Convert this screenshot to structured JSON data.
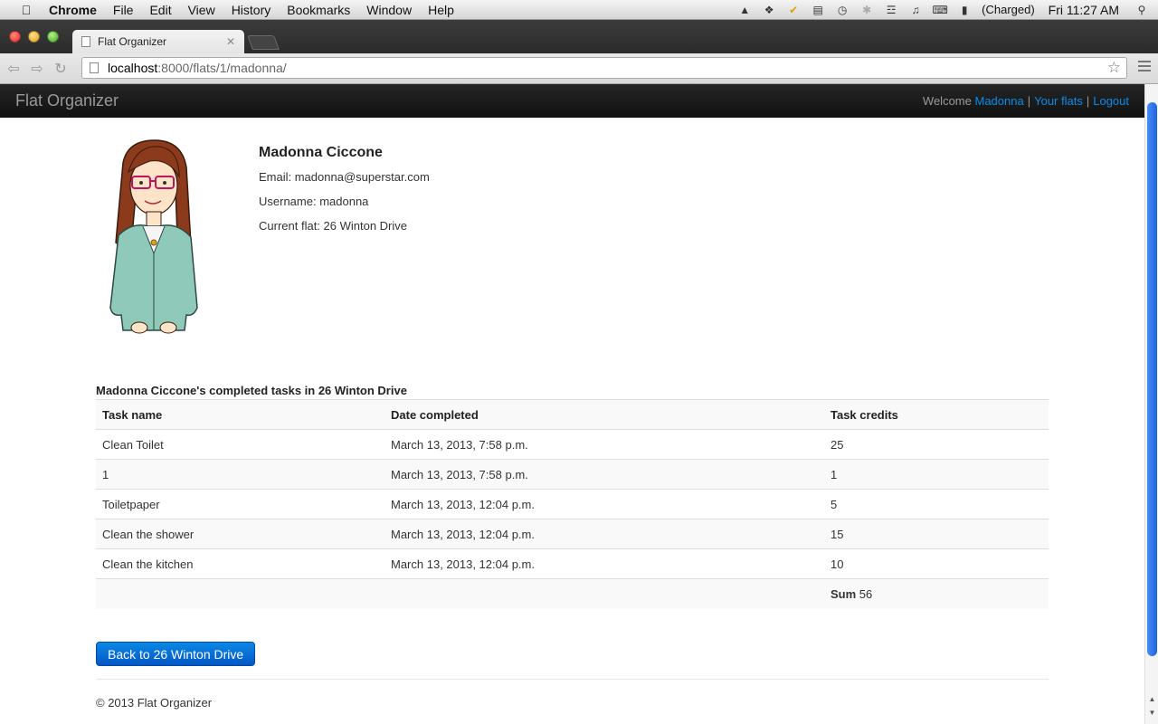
{
  "menubar": {
    "app": "Chrome",
    "items": [
      "File",
      "Edit",
      "View",
      "History",
      "Bookmarks",
      "Window",
      "Help"
    ],
    "battery": "(Charged)",
    "clock": "Fri 11:27 AM"
  },
  "browser": {
    "tab_title": "Flat Organizer",
    "url_host": "localhost",
    "url_path": ":8000/flats/1/madonna/"
  },
  "site": {
    "brand": "Flat Organizer",
    "welcome": "Welcome",
    "user_link": "Madonna",
    "flats_link": "Your flats",
    "logout_link": "Logout"
  },
  "profile": {
    "name": "Madonna Ciccone",
    "email": "Email: madonna@superstar.com",
    "username": "Username: madonna",
    "flat": "Current flat: 26 Winton Drive"
  },
  "tasks": {
    "caption": "Madonna Ciccone's completed tasks in 26 Winton Drive",
    "headers": [
      "Task name",
      "Date completed",
      "Task credits"
    ],
    "rows": [
      [
        "Clean Toilet",
        "March 13, 2013, 7:58 p.m.",
        "25"
      ],
      [
        "1",
        "March 13, 2013, 7:58 p.m.",
        "1"
      ],
      [
        "Toiletpaper",
        "March 13, 2013, 12:04 p.m.",
        "5"
      ],
      [
        "Clean the shower",
        "March 13, 2013, 12:04 p.m.",
        "15"
      ],
      [
        "Clean the kitchen",
        "March 13, 2013, 12:04 p.m.",
        "10"
      ]
    ],
    "sum_label": "Sum",
    "sum_value": "56"
  },
  "back_button": "Back to 26 Winton Drive",
  "footer": "© 2013 Flat Organizer"
}
